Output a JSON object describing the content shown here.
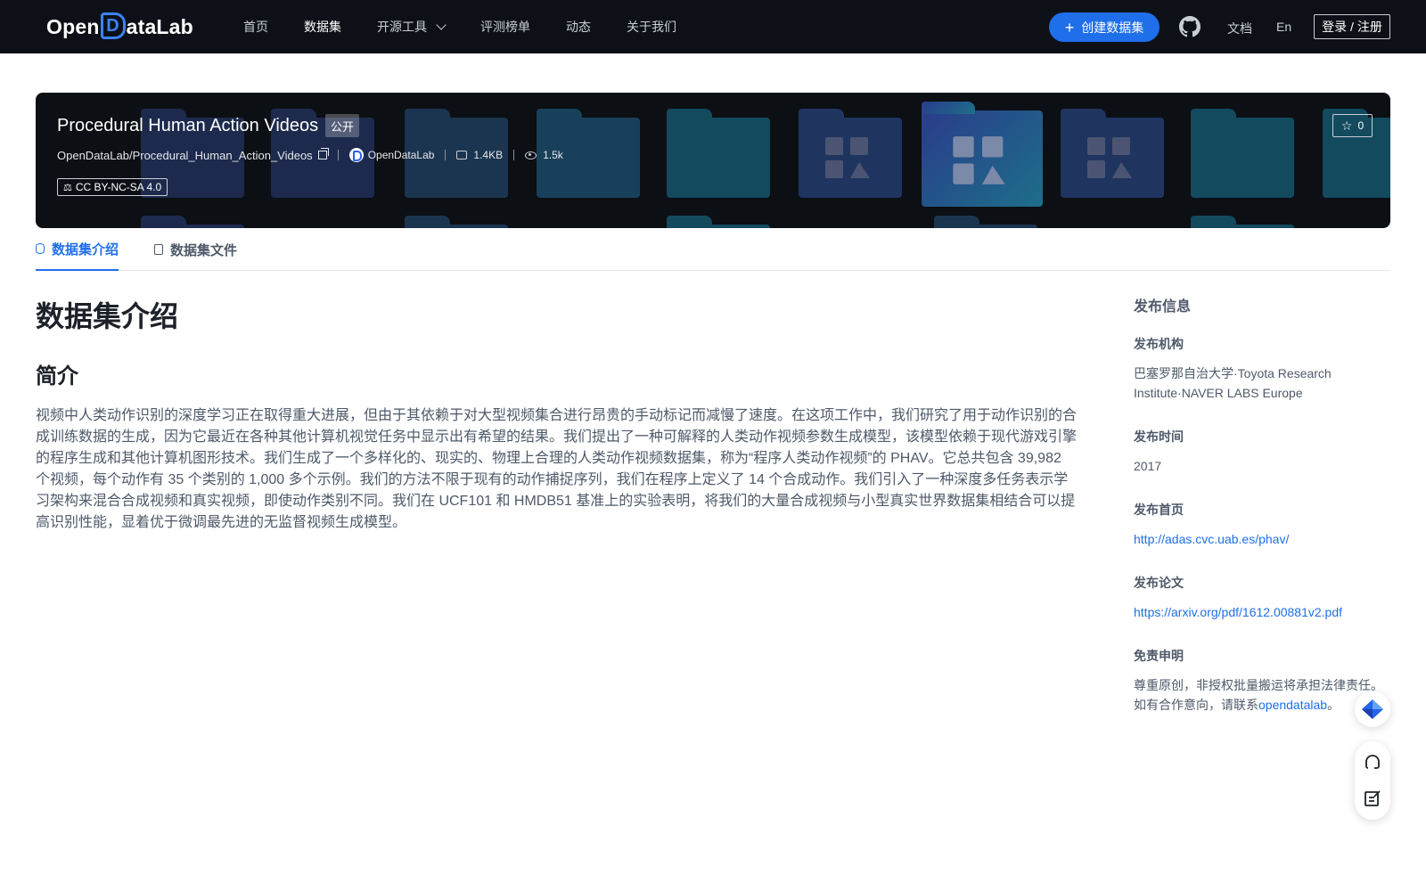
{
  "brand": {
    "name_prefix": "Open",
    "name_d": "D",
    "name_suffix": "ataLab"
  },
  "nav": {
    "items": [
      {
        "label": "首页",
        "active": false
      },
      {
        "label": "数据集",
        "active": true
      },
      {
        "label": "开源工具",
        "active": false,
        "has_dropdown": true
      },
      {
        "label": "评测榜单",
        "active": false
      },
      {
        "label": "动态",
        "active": false
      },
      {
        "label": "关于我们",
        "active": false
      }
    ],
    "create_button": "创建数据集",
    "docs": "文档",
    "lang": "En",
    "login": "登录 / 注册"
  },
  "dataset": {
    "title": "Procedural Human Action Videos",
    "visibility": "公开",
    "repo": "OpenDataLab/Procedural_Human_Action_Videos",
    "publisher": "OpenDataLab",
    "size": "1.4KB",
    "views": "1.5k",
    "license": "CC BY-NC-SA 4.0",
    "stars": "0"
  },
  "tabs": [
    {
      "label": "数据集介绍",
      "active": true
    },
    {
      "label": "数据集文件",
      "active": false
    }
  ],
  "content": {
    "heading": "数据集介绍",
    "subheading": "简介",
    "paragraph": "视频中人类动作识别的深度学习正在取得重大进展，但由于其依赖于对大型视频集合进行昂贵的手动标记而减慢了速度。在这项工作中，我们研究了用于动作识别的合成训练数据的生成，因为它最近在各种其他计算机视觉任务中显示出有希望的结果。我们提出了一种可解释的人类动作视频参数生成模型，该模型依赖于现代游戏引擎的程序生成和其他计算机图形技术。我们生成了一个多样化的、现实的、物理上合理的人类动作视频数据集，称为“程序人类动作视频”的 PHAV。它总共包含 39,982 个视频，每个动作有 35 个类别的 1,000 多个示例。我们的方法不限于现有的动作捕捉序列，我们在程序上定义了 14 个合成动作。我们引入了一种深度多任务表示学习架构来混合合成视频和真实视频，即使动作类别不同。我们在 UCF101 和 HMDB51 基准上的实验表明，将我们的大量合成视频与小型真实世界数据集相结合可以提高识别性能，显着优于微调最先进的无监督视频生成模型。"
  },
  "side": {
    "title": "发布信息",
    "org_label": "发布机构",
    "org_value": "巴塞罗那自治大学·Toyota Research Institute·NAVER LABS Europe",
    "time_label": "发布时间",
    "time_value": "2017",
    "home_label": "发布首页",
    "home_value": "http://adas.cvc.uab.es/phav/",
    "paper_label": "发布论文",
    "paper_value": "https://arxiv.org/pdf/1612.00881v2.pdf",
    "disclaimer_label": "免责申明",
    "disclaimer_line1": "尊重原创，非授权批量搬运将承担法律责任。",
    "disclaimer_line2_prefix": "如有合作意向，请联系",
    "disclaimer_link": "opendatalab",
    "disclaimer_suffix": "。"
  },
  "colors": {
    "accent": "#1f6feb",
    "nav_bg": "#0d1117",
    "banner_bg": "#0c0f14"
  },
  "icons": [
    "github-icon",
    "plus-icon",
    "chevron-down-icon",
    "copy-icon",
    "star-icon",
    "eye-icon",
    "disk-icon",
    "scale-icon",
    "database-icon",
    "file-icon",
    "feedback-icon",
    "headset-icon",
    "edit-icon"
  ]
}
